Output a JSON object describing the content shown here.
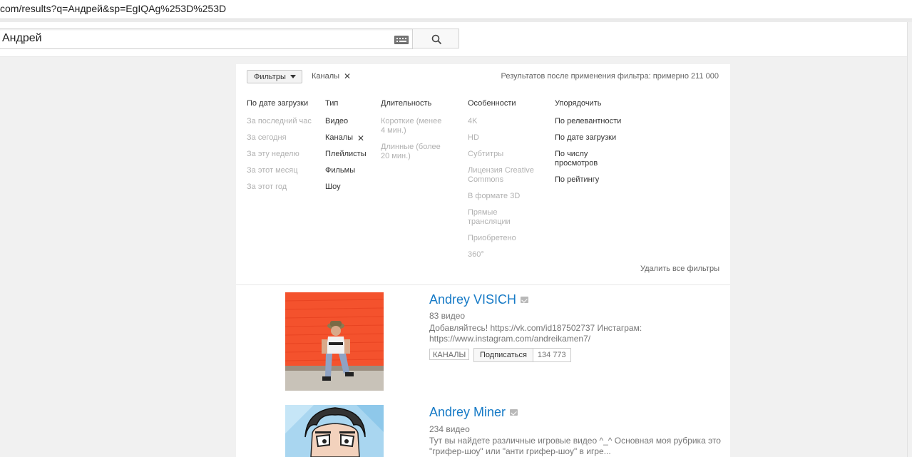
{
  "browser": {
    "url": "com/results?q=Андрей&sp=EgIQAg%253D%253D"
  },
  "search": {
    "query": "Андрей",
    "keyboard_icon": "keyboard-icon",
    "button_icon": "search-icon"
  },
  "filters": {
    "button_label": "Фильтры",
    "active_chip": "Каналы",
    "result_count": "Результатов после применения фильтра: примерно 211 000",
    "remove_all": "Удалить все фильтры",
    "columns": [
      {
        "heading": "По дате загрузки",
        "options": [
          "За последний час",
          "За сегодня",
          "За эту неделю",
          "За этот месяц",
          "За этот год"
        ]
      },
      {
        "heading": "Тип",
        "options": [
          "Видео",
          "Каналы",
          "Плейлисты",
          "Фильмы",
          "Шоу"
        ]
      },
      {
        "heading": "Длительность",
        "options": [
          "Короткие (менее 4 мин.)",
          "Длинные (более 20 мин.)"
        ]
      },
      {
        "heading": "Особенности",
        "options": [
          "4K",
          "HD",
          "Субтитры",
          "Лицензия Creative Commons",
          "В формате 3D",
          "Прямые трансляции",
          "Приобретено",
          "360°"
        ]
      },
      {
        "heading": "Упорядочить",
        "options": [
          "По релевантности",
          "По дате загрузки",
          "По числу просмотров",
          "По рейтингу"
        ]
      }
    ]
  },
  "results": [
    {
      "title": "Andrey VISICH",
      "meta": "83 видео",
      "description": "Добавляйтесь! https://vk.com/id187502737 Инстаграм: https://www.instagram.com/andreikamen7/",
      "badge": "КАНАЛЫ",
      "subscribe_label": "Подписаться",
      "subscriber_count": "134 773",
      "colors": {
        "thumb_bg": "#f4522d"
      }
    },
    {
      "title": "Andrey Miner",
      "meta": "234 видео",
      "description": "Тут вы найдете различные игровые видео ^_^ Основная моя рубрика это \"грифер-шоу\" или \"анти грифер-шоу\" в игре...",
      "colors": {
        "thumb_bg": "#a9d6f0"
      }
    }
  ],
  "colors": {
    "link": "#167ac6",
    "page_bg": "#f1f1f1"
  }
}
